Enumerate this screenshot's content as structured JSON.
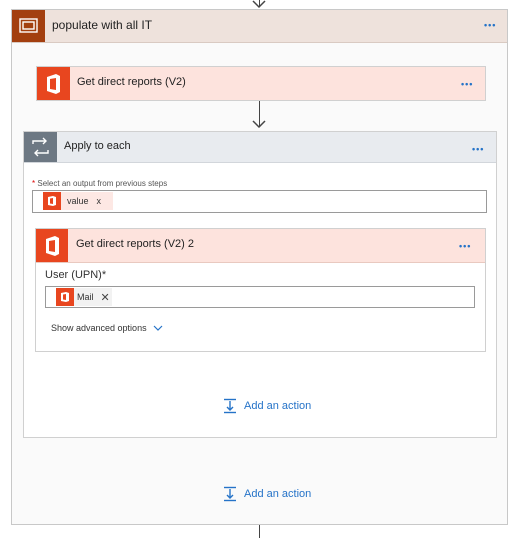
{
  "scope": {
    "title": "populate with all IT",
    "icon": "scope-icon",
    "menu_glyph": "•••"
  },
  "action1": {
    "title": "Get direct reports (V2)",
    "icon": "office365-icon",
    "menu_glyph": "•••"
  },
  "apply_to_each": {
    "title": "Apply to each",
    "icon": "loop-icon",
    "menu_glyph": "•••",
    "required_marker": "*",
    "select_label": "Select an output from previous steps",
    "token_label": "value",
    "token_remove": "x"
  },
  "action2": {
    "title": "Get direct reports (V2) 2",
    "icon": "office365-icon",
    "menu_glyph": "•••",
    "field_label": "User (UPN)",
    "required_marker": "*",
    "token_label": "Mail",
    "token_remove": "✕",
    "advanced_label": "Show advanced options"
  },
  "add_action_inner": {
    "label": "Add an action",
    "icon": "add-action-icon"
  },
  "add_action_outer": {
    "label": "Add an action",
    "icon": "add-action-icon"
  },
  "colors": {
    "scope_icon_bg": "#a33f0f",
    "scope_header_bg": "#eee2dc",
    "o365_red": "#e8461f",
    "o365_header_bg": "#fde3dd",
    "apply_header_bg": "#e8ebef",
    "apply_icon_bg": "#6d7883",
    "link_blue": "#2573c8"
  }
}
